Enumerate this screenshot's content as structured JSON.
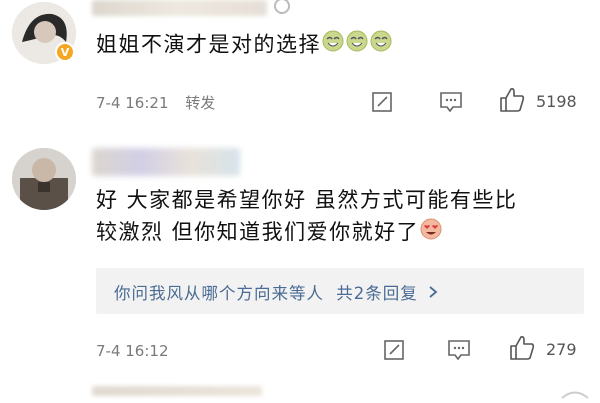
{
  "comments": [
    {
      "text": "姐姐不演才是对的选择",
      "emoji": "laughing-face-x3",
      "time": "7-4 16:21",
      "forward_label": "转发",
      "likes": "5198"
    },
    {
      "text_line1": "好 大家都是希望你好 虽然方式可能有些比",
      "text_line2": "较激烈 但你知道我们爱你就好了",
      "emoji": "heart-eyes-face",
      "reply_summary": "你问我风从哪个方向来等人",
      "reply_count": "共2条回复",
      "time": "7-4 16:12",
      "likes": "279"
    }
  ],
  "colors": {
    "link": "#4a6b93",
    "meta": "#7a7a7a",
    "reply_bg": "#f2f2f2"
  }
}
